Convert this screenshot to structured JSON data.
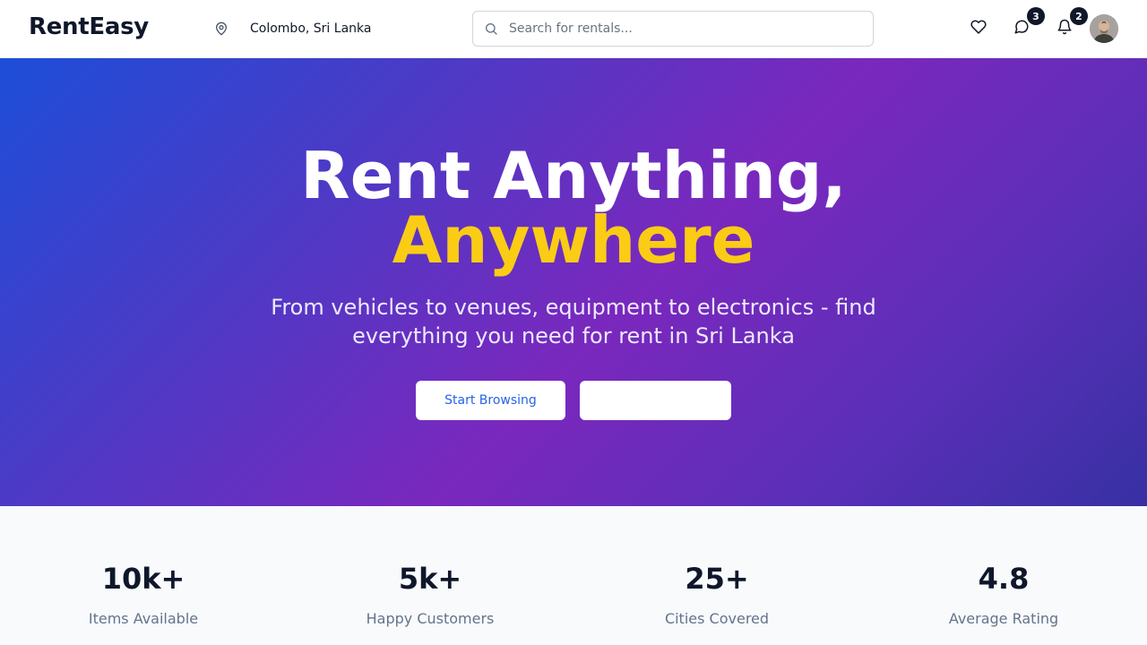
{
  "header": {
    "logo": "RentEasy",
    "location": "Colombo, Sri Lanka",
    "location_icon": "map-pin-icon",
    "search_placeholder": "Search for rentals...",
    "search_icon": "search-icon",
    "favorites_icon": "heart-icon",
    "messages_icon": "message-circle-icon",
    "messages_count": "3",
    "notifications_icon": "bell-icon",
    "notifications_count": "2",
    "avatar_icon": "user-avatar"
  },
  "hero": {
    "title_line1": "Rent Anything,",
    "title_line2": "Anywhere",
    "subtitle": "From vehicles to venues, equipment to electronics - find everything you need for rent in Sri Lanka",
    "primary_button": "Start Browsing",
    "secondary_button": "",
    "colors": {
      "gradient_start": "#1d4ed8",
      "gradient_mid": "#7a28bd",
      "gradient_end": "#3730a3",
      "accent": "#facc15"
    }
  },
  "stats": [
    {
      "value": "10k+",
      "label": "Items Available"
    },
    {
      "value": "5k+",
      "label": "Happy Customers"
    },
    {
      "value": "25+",
      "label": "Cities Covered"
    },
    {
      "value": "4.8",
      "label": "Average Rating"
    }
  ]
}
